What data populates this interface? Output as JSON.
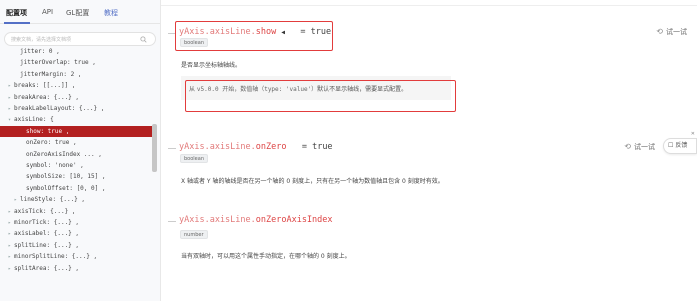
{
  "tabs": [
    {
      "label": "配置项",
      "active": true
    },
    {
      "label": "API",
      "active": false
    },
    {
      "label": "GL配置",
      "active": false
    },
    {
      "label": "教程",
      "active": false
    }
  ],
  "search": {
    "placeholder": "搜索文档，请先选择文档项"
  },
  "tree": [
    {
      "text": "jitter: 0 ,",
      "arrow": ""
    },
    {
      "text": "jitterOverlap: true ,",
      "arrow": ""
    },
    {
      "text": "jitterMargin: 2 ,",
      "arrow": ""
    },
    {
      "text": "breaks: [[...]] ,",
      "arrow": "▸"
    },
    {
      "text": "breakArea: {...} ,",
      "arrow": "▸"
    },
    {
      "text": "breakLabelLayout: {...} ,",
      "arrow": "▸"
    },
    {
      "text": "axisLine: {",
      "arrow": "▾"
    },
    {
      "text": "show: true ,",
      "arrow": "",
      "selected": true
    },
    {
      "text": "onZero: true ,",
      "arrow": ""
    },
    {
      "text": "onZeroAxisIndex ... ,",
      "arrow": ""
    },
    {
      "text": "symbol: 'none' ,",
      "arrow": ""
    },
    {
      "text": "symbolSize: [10, 15] ,",
      "arrow": ""
    },
    {
      "text": "symbolOffset: [0, 0] ,",
      "arrow": ""
    },
    {
      "text": "lineStyle: {...} ,",
      "arrow": "▸"
    },
    {
      "text": "axisTick: {...} ,",
      "arrow": "▸"
    },
    {
      "text": "minorTick: {...} ,",
      "arrow": "▸"
    },
    {
      "text": "axisLabel: {...} ,",
      "arrow": "▸"
    },
    {
      "text": "splitLine: {...} ,",
      "arrow": "▸"
    },
    {
      "text": "minorSplitLine: {...} ,",
      "arrow": "▸"
    },
    {
      "text": "splitArea: {...} ,",
      "arrow": "▸"
    }
  ],
  "sections": [
    {
      "prefix": "yAxis.axisLine.",
      "prop": "show",
      "marker": "◀",
      "default": "= true",
      "type": "boolean",
      "desc": "是否显示坐标轴轴线。",
      "note": {
        "pre": "从 ",
        "code": "v5.0.0 开始，数值轴（type: 'value'）",
        "post": "默认不显示轴线，需要显式配置。"
      }
    },
    {
      "prefix": "yAxis.axisLine.",
      "prop": "onZero",
      "default": "= true",
      "type": "boolean",
      "desc": "X 轴或者 Y 轴的轴线是否在另一个轴的 0 刻度上，只有在另一个轴为数值轴且包含 0 刻度时有效。"
    },
    {
      "prefix": "yAxis.axisLine.",
      "prop": "onZeroAxisIndex",
      "type": "number",
      "desc": "当有双轴时，可以用这个属性手动指定，在哪个轴的 0 刻度上。"
    }
  ],
  "try_label": "试一试",
  "feedback_label": "反馈",
  "colors": {
    "accent": "#5470c6",
    "selected": "#b32020",
    "highlight_box": "#e23c3c"
  }
}
